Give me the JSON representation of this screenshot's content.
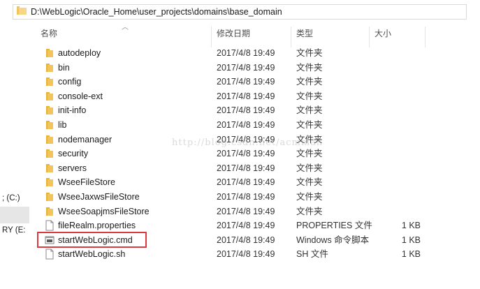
{
  "address_bar": {
    "path": "D:\\WebLogic\\Oracle_Home\\user_projects\\domains\\base_domain"
  },
  "nav": {
    "items": [
      {
        "label": "; (C:)"
      },
      {
        "label": "RY (E:"
      }
    ]
  },
  "columns": {
    "name": "名称",
    "date": "修改日期",
    "type": "类型",
    "size": "大小"
  },
  "watermark": "http://blog.csdn.net/acmman",
  "files": [
    {
      "name": "autodeploy",
      "date": "2017/4/8 19:49",
      "type": "文件夹",
      "size": "",
      "kind": "folder"
    },
    {
      "name": "bin",
      "date": "2017/4/8 19:49",
      "type": "文件夹",
      "size": "",
      "kind": "folder"
    },
    {
      "name": "config",
      "date": "2017/4/8 19:49",
      "type": "文件夹",
      "size": "",
      "kind": "folder"
    },
    {
      "name": "console-ext",
      "date": "2017/4/8 19:49",
      "type": "文件夹",
      "size": "",
      "kind": "folder"
    },
    {
      "name": "init-info",
      "date": "2017/4/8 19:49",
      "type": "文件夹",
      "size": "",
      "kind": "folder"
    },
    {
      "name": "lib",
      "date": "2017/4/8 19:49",
      "type": "文件夹",
      "size": "",
      "kind": "folder"
    },
    {
      "name": "nodemanager",
      "date": "2017/4/8 19:49",
      "type": "文件夹",
      "size": "",
      "kind": "folder"
    },
    {
      "name": "security",
      "date": "2017/4/8 19:49",
      "type": "文件夹",
      "size": "",
      "kind": "folder"
    },
    {
      "name": "servers",
      "date": "2017/4/8 19:49",
      "type": "文件夹",
      "size": "",
      "kind": "folder"
    },
    {
      "name": "WseeFileStore",
      "date": "2017/4/8 19:49",
      "type": "文件夹",
      "size": "",
      "kind": "folder"
    },
    {
      "name": "WseeJaxwsFileStore",
      "date": "2017/4/8 19:49",
      "type": "文件夹",
      "size": "",
      "kind": "folder"
    },
    {
      "name": "WseeSoapjmsFileStore",
      "date": "2017/4/8 19:49",
      "type": "文件夹",
      "size": "",
      "kind": "folder"
    },
    {
      "name": "fileRealm.properties",
      "date": "2017/4/8 19:49",
      "type": "PROPERTIES 文件",
      "size": "1 KB",
      "kind": "file"
    },
    {
      "name": "startWebLogic.cmd",
      "date": "2017/4/8 19:49",
      "type": "Windows 命令脚本",
      "size": "1 KB",
      "kind": "cmd"
    },
    {
      "name": "startWebLogic.sh",
      "date": "2017/4/8 19:49",
      "type": "SH 文件",
      "size": "1 KB",
      "kind": "file"
    }
  ],
  "highlight_color": "#e0383e",
  "folder_color": "#f2c55c"
}
